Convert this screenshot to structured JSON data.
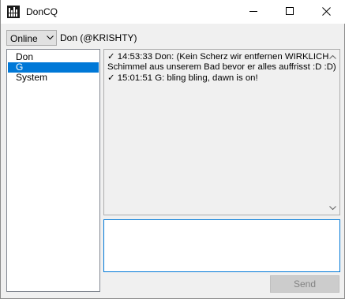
{
  "window": {
    "title": "DonCQ",
    "icon": "doncq-app-icon",
    "controls": [
      "minimize-icon",
      "maximize-icon",
      "close-icon"
    ]
  },
  "toolbar": {
    "status": "Online",
    "user": "Don (@KRISHTY)"
  },
  "contacts": [
    {
      "name": "Don",
      "selected": false
    },
    {
      "name": "G",
      "selected": true
    },
    {
      "name": "System",
      "selected": false
    }
  ],
  "messages": [
    {
      "lines": [
        "✓ 14:53:33 Don: (Kein Scherz wir entfernen WIRKLICH",
        "Schimmel aus unserem Bad bevor er alles auffrisst :D :D)"
      ]
    },
    {
      "lines": [
        "✓ 15:01:51 G: bling bling, dawn is on!"
      ]
    }
  ],
  "input": {
    "value": ""
  },
  "send_label": "Send",
  "colors": {
    "selection": "#0078d7",
    "focus_border": "#0078d7"
  }
}
